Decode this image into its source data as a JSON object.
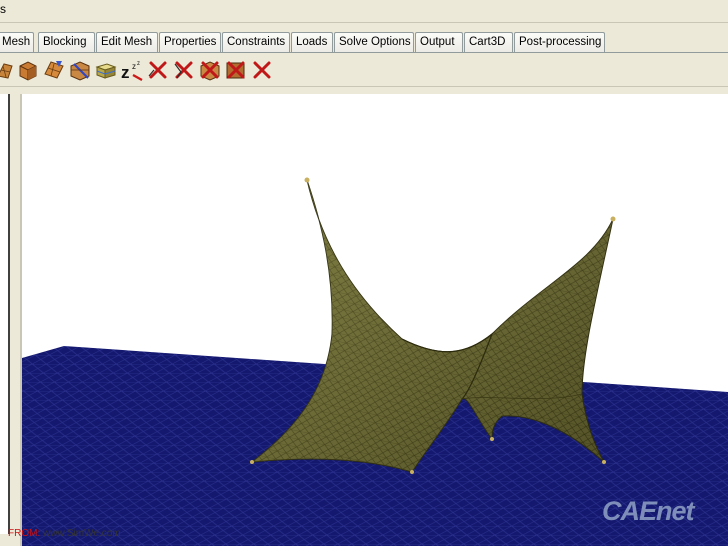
{
  "window": {
    "title_fragment": "s"
  },
  "tabs": [
    {
      "label": "Mesh"
    },
    {
      "label": "Blocking"
    },
    {
      "label": "Edit Mesh"
    },
    {
      "label": "Properties"
    },
    {
      "label": "Constraints"
    },
    {
      "label": "Loads"
    },
    {
      "label": "Solve Options"
    },
    {
      "label": "Output"
    },
    {
      "label": "Cart3D"
    },
    {
      "label": "Post-processing"
    }
  ],
  "toolbar": {
    "icons": [
      "mesh-surface-icon",
      "volume-mesh-icon",
      "shell-mesh-icon",
      "delete-mesh-icon",
      "prism-mesh-icon",
      "sleep-zzz-icon",
      "delete-x-icon",
      "delete-x-icon",
      "delete-block-icon",
      "delete-box-icon",
      "delete-x-icon"
    ],
    "sleep_text": "z"
  },
  "viewport": {
    "colors": {
      "ground": "#14186e",
      "ground_mesh": "#3a3f9a",
      "membrane": "#6b6a35",
      "membrane_light": "#8a8848",
      "membrane_mesh": "#2f2e12",
      "anchor": "#c8b060"
    }
  },
  "footer": {
    "from_label": "FROM:",
    "from_site": "www.SimWe.com"
  },
  "watermark": {
    "text": "CAEnet"
  }
}
